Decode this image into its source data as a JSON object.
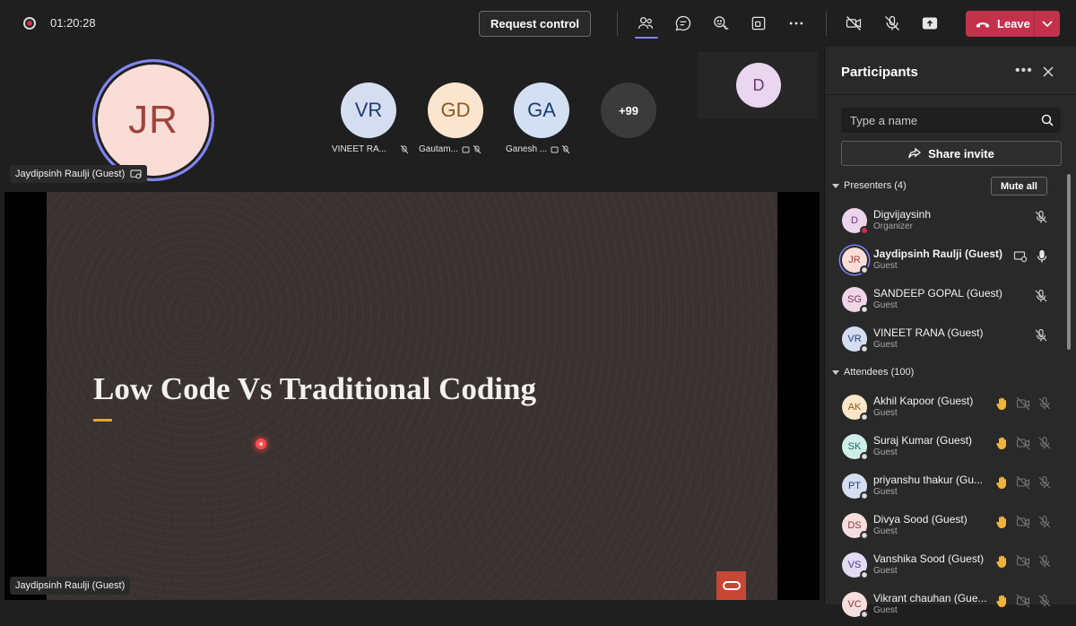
{
  "topbar": {
    "timer": "01:20:28",
    "request_control": "Request control",
    "leave": "Leave"
  },
  "stage": {
    "spotlight": {
      "initials": "JR",
      "name": "Jaydipsinh Raulji (Guest)"
    },
    "gallery": [
      {
        "initials": "VR",
        "name": "VINEET RA...",
        "bg": "#d5def0",
        "fg": "#1f3b74"
      },
      {
        "initials": "GD",
        "name": "Gautam...",
        "bg": "#fbe5cf",
        "fg": "#8a5a1e"
      },
      {
        "initials": "GA",
        "name": "Ganesh ...",
        "bg": "#d3e0f3",
        "fg": "#1c3c6e"
      }
    ],
    "overflow_count": "+99",
    "self_tile": {
      "initials": "D"
    },
    "slide": {
      "title": "Low Code Vs Traditional Coding"
    },
    "presenter_tag": "Jaydipsinh Raulji (Guest)"
  },
  "panel": {
    "title": "Participants",
    "search_placeholder": "Type a name",
    "share_invite": "Share invite",
    "presenters_label": "Presenters (4)",
    "mute_all": "Mute all",
    "attendees_label": "Attendees (100)",
    "presenters": [
      {
        "initials": "D",
        "name": "Digvijaysinh",
        "role": "Organizer",
        "bg": "#ecd5ea",
        "fg": "#6b3a75"
      },
      {
        "initials": "JR",
        "name": "Jaydipsinh Raulji (Guest)",
        "role": "Guest",
        "bg": "#fbddd8",
        "fg": "#a1433a"
      },
      {
        "initials": "SG",
        "name": "SANDEEP GOPAL (Guest)",
        "role": "Guest",
        "bg": "#eed6e6",
        "fg": "#7a2f5f"
      },
      {
        "initials": "VR",
        "name": "VINEET RANA (Guest)",
        "role": "Guest",
        "bg": "#d5def0",
        "fg": "#1f3b74"
      }
    ],
    "attendees": [
      {
        "initials": "AK",
        "name": "Akhil Kapoor (Guest)",
        "role": "Guest",
        "bg": "#fbe7c8",
        "fg": "#8a5a1e"
      },
      {
        "initials": "SK",
        "name": "Suraj Kumar (Guest)",
        "role": "Guest",
        "bg": "#cfeee8",
        "fg": "#1f6b5c"
      },
      {
        "initials": "PT",
        "name": "priyanshu thakur (Gu...",
        "role": "Guest",
        "bg": "#d5def0",
        "fg": "#1f3b74"
      },
      {
        "initials": "DS",
        "name": "Divya Sood (Guest)",
        "role": "Guest",
        "bg": "#f6dede",
        "fg": "#8a3a3a"
      },
      {
        "initials": "VS",
        "name": "Vanshika Sood (Guest)",
        "role": "Guest",
        "bg": "#e2dcf3",
        "fg": "#4a3a8a"
      },
      {
        "initials": "VC",
        "name": "Vikrant chauhan (Gue...",
        "role": "Guest",
        "bg": "#f6dede",
        "fg": "#8a3a3a"
      }
    ]
  }
}
